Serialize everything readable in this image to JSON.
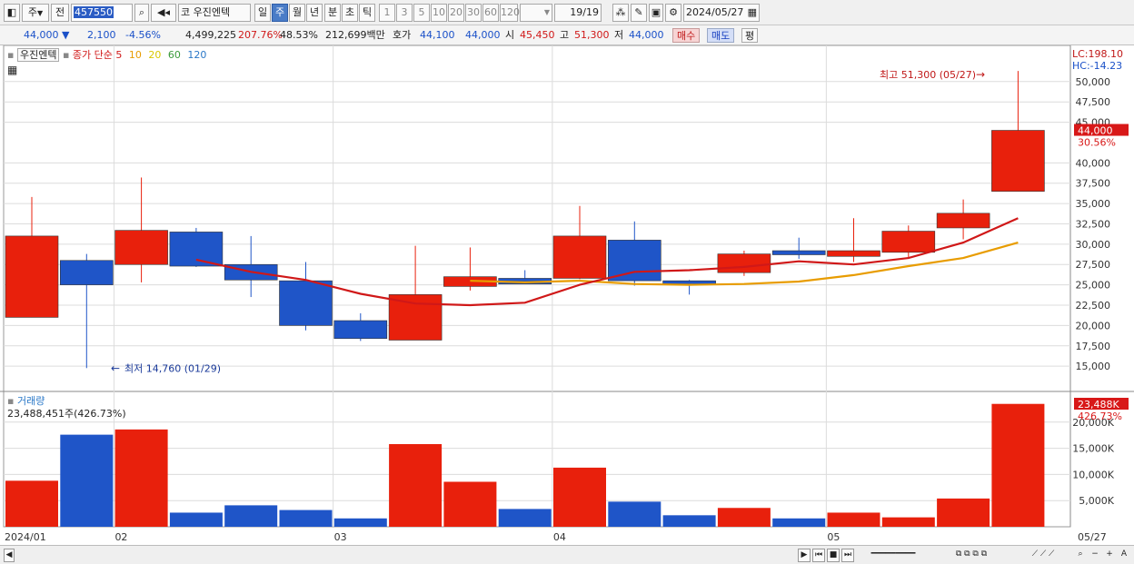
{
  "toolbar": {
    "market_label": "주",
    "market_arrow": "▼",
    "prev_label": "전",
    "stock_code": "457550",
    "stock_name_prefix": "코",
    "stock_name": "우진엔텍",
    "periods": [
      "일",
      "주",
      "월",
      "년",
      "분",
      "초",
      "틱"
    ],
    "selected_period": "주",
    "intervals": [
      "1",
      "3",
      "5",
      "10",
      "20",
      "30",
      "60",
      "120"
    ],
    "page_count": "19/19",
    "date": "2024/05/27"
  },
  "infobar": {
    "price": "44,000",
    "price_arrow": "▼",
    "change": "2,100",
    "change_pct": "-4.56%",
    "volume": "4,499,225",
    "vol_ratio": "207.76%",
    "turnover": "48.53%",
    "amount": "212,699백만",
    "hoga_label": "호가",
    "ask": "44,100",
    "bid": "44,000",
    "open_label": "시",
    "open": "45,450",
    "high_label": "고",
    "high": "51,300",
    "low_label": "저",
    "low": "44,000",
    "buy_label": "매수",
    "sell_label": "매도",
    "eval_label": "평"
  },
  "legend": {
    "stock": "우진엔텍",
    "ma_label": "종가 단순",
    "ma_periods": [
      "5",
      "10",
      "20",
      "60",
      "120"
    ],
    "ma_colors": [
      "#d01818",
      "#e89c00",
      "#d8c800",
      "#3a9a3a",
      "#2a78c8"
    ],
    "volume_label": "거래량",
    "volume_value": "23,488,451주(426.73%)"
  },
  "chart_data": {
    "type": "candlestick",
    "x": [
      "2024/01/1",
      "2024/01/2",
      "2024/02/1",
      "2024/02/2",
      "2024/02/3",
      "2024/02/4",
      "2024/03/1",
      "2024/03/2",
      "2024/03/3",
      "2024/03/4",
      "2024/04/1",
      "2024/04/2",
      "2024/04/3",
      "2024/04/4",
      "2024/05/1",
      "2024/05/2",
      "2024/05/3",
      "2024/05/4",
      "2024/05/27"
    ],
    "open": [
      21000,
      28000,
      27500,
      31500,
      27500,
      25500,
      20600,
      18200,
      24800,
      25800,
      25800,
      30500,
      25500,
      26500,
      29200,
      28500,
      29000,
      32000,
      36500
    ],
    "close": [
      31000,
      25000,
      31700,
      27300,
      25600,
      20000,
      18400,
      23800,
      26000,
      25100,
      31000,
      25500,
      25000,
      28800,
      28700,
      29200,
      31600,
      33800,
      44000
    ],
    "high": [
      35800,
      28800,
      38200,
      32000,
      31000,
      27800,
      21500,
      29800,
      29600,
      26800,
      34700,
      32800,
      25600,
      29200,
      30800,
      33200,
      32300,
      35500,
      51300
    ],
    "low": [
      21000,
      14760,
      25300,
      27200,
      23500,
      19400,
      18100,
      18200,
      24300,
      25100,
      25700,
      24900,
      23800,
      26100,
      28200,
      27800,
      28400,
      30600,
      36500
    ],
    "volume_k": [
      8800,
      17600,
      18600,
      2700,
      4100,
      3200,
      1600,
      15800,
      8600,
      3400,
      11300,
      4800,
      2200,
      3600,
      1600,
      2700,
      1800,
      5400,
      23488
    ],
    "ma5": [
      null,
      null,
      null,
      null,
      28100,
      26600,
      25600,
      23900,
      22700,
      22500,
      22800,
      25000,
      26600,
      26800,
      27200,
      27900,
      27500,
      28300,
      30200,
      33200
    ],
    "ma10": [
      null,
      null,
      null,
      null,
      null,
      null,
      null,
      null,
      null,
      25500,
      25300,
      25500,
      25100,
      25000,
      25100,
      25400,
      26200,
      27300,
      28300,
      30200
    ],
    "ma5_x": [
      4,
      5,
      6,
      7,
      8,
      9,
      10,
      11,
      12,
      13,
      14,
      15,
      16,
      17,
      18
    ],
    "up_color": "#e8200c",
    "down_color": "#1f55c8",
    "price_ticks": [
      "15,000",
      "17,500",
      "20,000",
      "22,500",
      "25,000",
      "27,500",
      "30,000",
      "32,500",
      "35,000",
      "37,500",
      "40,000",
      "45,000",
      "47,500",
      "50,000"
    ],
    "volume_ticks": [
      "5,000K",
      "10,000K",
      "15,000K",
      "20,000K"
    ],
    "x_labels": [
      "2024/01",
      "02",
      "03",
      "04",
      "05"
    ],
    "x_label_end": "05/27",
    "lc": "LC:198.10",
    "hc": "HC:-14.23",
    "last_price": "44,000",
    "last_pct": "30.56%",
    "last_volume": "23,488K",
    "last_vol_pct": "426.73%",
    "high_note": "최고 51,300 (05/27)",
    "low_note": "최저 14,760 (01/29)"
  }
}
